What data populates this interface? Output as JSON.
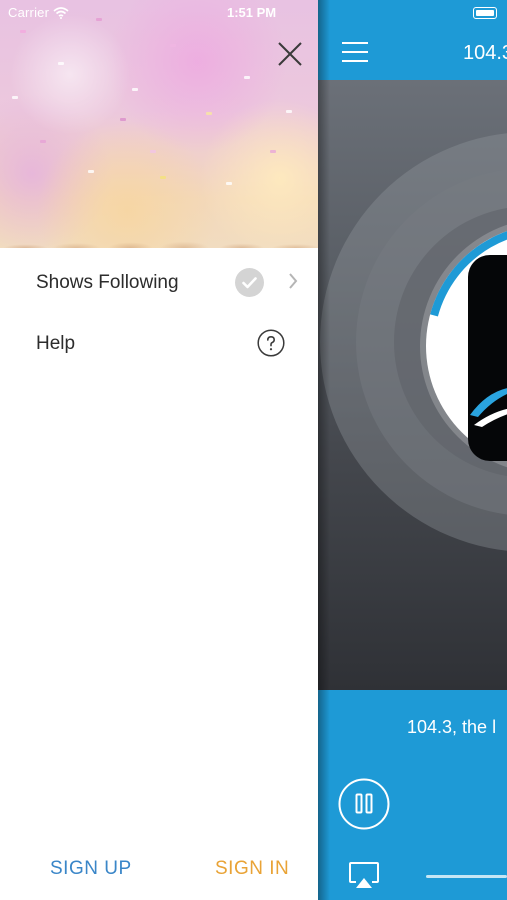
{
  "status_bar": {
    "carrier": "Carrier",
    "time": "1:51 PM"
  },
  "drawer": {
    "menu_items": [
      {
        "label": "Shows Following",
        "badge": "check-icon",
        "chevron": "chevron-right-icon"
      },
      {
        "label": "Help",
        "badge": "question-icon"
      }
    ],
    "sign_up_label": "SIGN UP",
    "sign_in_label": "SIGN IN"
  },
  "player": {
    "station_title": "104.3",
    "now_playing": "104.3, the l"
  },
  "colors": {
    "brand_blue": "#1e9ad6",
    "sign_up": "#3a86c8",
    "sign_in": "#e9a336",
    "text": "#2c2c2c"
  },
  "icons": {
    "close": "close-icon",
    "menu": "hamburger-menu-icon",
    "pause": "pause-icon",
    "airplay": "airplay-icon",
    "wifi": "wifi-icon",
    "battery": "battery-icon"
  }
}
